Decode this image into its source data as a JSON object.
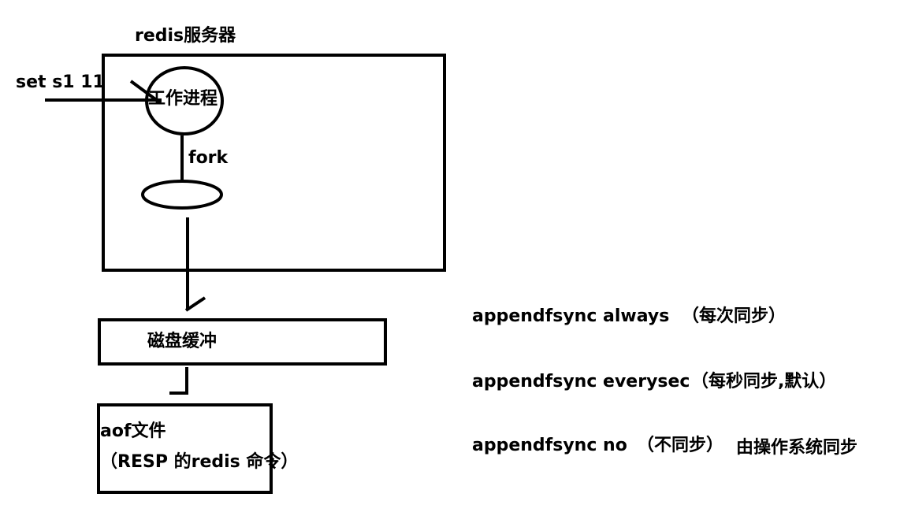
{
  "server": {
    "title": "redis服务器",
    "input_command": "set s1 11",
    "worker_label": "工作进程",
    "fork_label": "fork"
  },
  "buffer": {
    "label": "磁盘缓冲"
  },
  "aof": {
    "title": "aof文件",
    "subtitle": "（RESP 的redis 命令）"
  },
  "fsync_options": [
    {
      "command": "appendfsync always",
      "note": "（每次同步）",
      "extra": ""
    },
    {
      "command": "appendfsync everysec",
      "note": "（每秒同步,默认）",
      "extra": ""
    },
    {
      "command": "appendfsync no",
      "note": "（不同步）",
      "extra": "由操作系统同步"
    }
  ]
}
